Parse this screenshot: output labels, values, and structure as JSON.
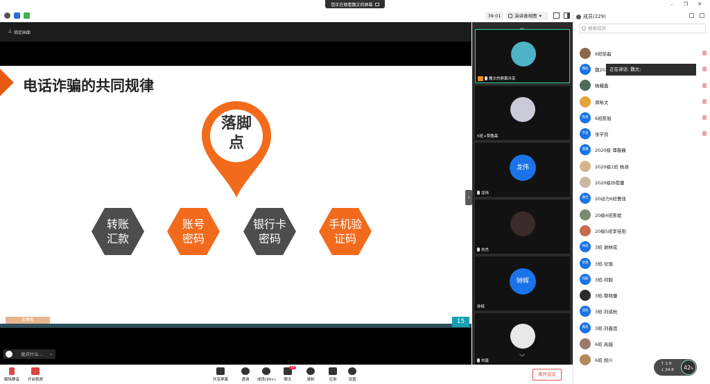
{
  "window": {
    "share_notice": "您正在观看魏文的屏幕"
  },
  "toolbar": {
    "timer": "39:01",
    "view_mode": "演讲者视图"
  },
  "stage": {
    "lock_label": "锁定画面",
    "chat_placeholder": "说点什么...",
    "slide": {
      "title": "电话诈骗的共同规律",
      "center_line1": "落脚",
      "center_line2": "点",
      "items": [
        {
          "line1": "转账",
          "line2": "汇款"
        },
        {
          "line1": "账号",
          "line2": "密码"
        },
        {
          "line1": "银行卡",
          "line2": "密码"
        },
        {
          "line1": "手机验",
          "line2": "证码"
        }
      ],
      "page_number": "15",
      "source_label": "有做爱"
    }
  },
  "video_tiles": [
    {
      "name": "魏文的屏幕共享"
    },
    {
      "name": "5班+贾敬森"
    },
    {
      "name": "龙伟",
      "avatar_text": "龙伟"
    },
    {
      "name": "刘杰"
    },
    {
      "name": "钟辉",
      "avatar_text": "钟辉"
    },
    {
      "name": "刘鑫"
    }
  ],
  "participants": {
    "header": "成员(229)",
    "search_placeholder": "搜索成员",
    "speaking_tooltip": "正在讲话: 魏文;",
    "list": [
      {
        "name": "6班徐磊",
        "avatar_text": "",
        "avatar_color": "#8a6a4a",
        "mic": "on"
      },
      {
        "name": "魏202",
        "avatar_text": "魏赵",
        "avatar_color": "#1a73e8",
        "mic": "on"
      },
      {
        "name": "杨耀鑫",
        "avatar_text": "",
        "avatar_color": "#4f6b5a",
        "mic": "on"
      },
      {
        "name": "周咏文",
        "avatar_text": "",
        "avatar_color": "#e2a33b",
        "mic": "muted"
      },
      {
        "name": "6班陈旭",
        "avatar_text": "陈旭",
        "avatar_color": "#1a73e8",
        "mic": "on"
      },
      {
        "name": "张学良",
        "avatar_text": "学良",
        "avatar_color": "#1a73e8",
        "mic": "on"
      },
      {
        "name": "2020级 谭晨巍",
        "avatar_text": "晨巍",
        "avatar_color": "#1a73e8",
        "mic": "none"
      },
      {
        "name": "2020级1班 杨涵",
        "avatar_text": "",
        "avatar_color": "#d6b48a",
        "mic": "none"
      },
      {
        "name": "2020级孙蓓蕾",
        "avatar_text": "",
        "avatar_color": "#c9b8a0",
        "mic": "none"
      },
      {
        "name": "20动力6班曹佳",
        "avatar_text": "曹佳",
        "avatar_color": "#1a73e8",
        "mic": "none"
      },
      {
        "name": "20级4班陈斌",
        "avatar_text": "",
        "avatar_color": "#7a8a70",
        "mic": "none"
      },
      {
        "name": "20级5班李佳阳",
        "avatar_text": "",
        "avatar_color": "#c56a4a",
        "mic": "none"
      },
      {
        "name": "3班 谢林成",
        "avatar_text": "林成",
        "avatar_color": "#1a73e8",
        "mic": "none"
      },
      {
        "name": "3班-甘琨",
        "avatar_text": "甘琨",
        "avatar_color": "#1a73e8",
        "mic": "none"
      },
      {
        "name": "3班-何毅",
        "avatar_text": "何毅",
        "avatar_color": "#1a73e8",
        "mic": "none"
      },
      {
        "name": "3班-黎晓蕾",
        "avatar_text": "",
        "avatar_color": "#2a2a2a",
        "mic": "none"
      },
      {
        "name": "3班-刘成杭",
        "avatar_text": "成杭",
        "avatar_color": "#1a73e8",
        "mic": "none"
      },
      {
        "name": "3班-刘鑫莲",
        "avatar_text": "鑫莲",
        "avatar_color": "#1a73e8",
        "mic": "none"
      },
      {
        "name": "6班 高越",
        "avatar_text": "",
        "avatar_color": "#9a7a6a",
        "mic": "none"
      },
      {
        "name": "6班 胡川",
        "avatar_text": "",
        "avatar_color": "#b58a5a",
        "mic": "none"
      }
    ]
  },
  "network": {
    "up": "1.9",
    "down": "24.8",
    "percent": "42"
  },
  "bottom_toolbar": {
    "unmute": "解除静音",
    "start_video": "开启视频",
    "share_screen": "共享屏幕",
    "invite": "邀请",
    "members": "成员(99+)",
    "chat": "聊天",
    "chat_badge": "16",
    "record": "录制",
    "apps": "应用",
    "settings": "设置",
    "leave": "离开会议"
  },
  "colors": {
    "accent_orange": "#f26b1d",
    "hex_dark": "#4d4d4d",
    "avatar_blue": "#1a73e8",
    "leave_red": "#e05050"
  }
}
